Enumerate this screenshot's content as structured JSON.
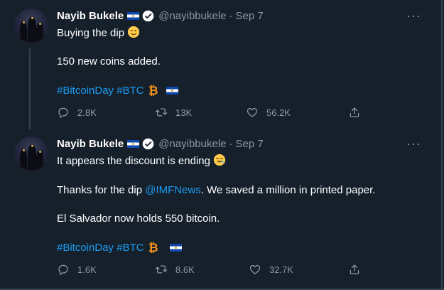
{
  "colors": {
    "background": "#15202b",
    "text": "#ffffff",
    "secondary": "#8b98a5",
    "link": "#1d9bf0",
    "bitcoin": "#f7931a"
  },
  "tweets": [
    {
      "author_name": "Nayib Bukele",
      "handle": "@nayibbukele",
      "separator": "·",
      "date": "Sep 7",
      "lines": {
        "line1": "Buying the dip",
        "line2": "150 new coins added.",
        "hashtag1": "#BitcoinDay",
        "hashtag2": "#BTC"
      },
      "replies": "2.8K",
      "retweets": "13K",
      "likes": "56.2K"
    },
    {
      "author_name": "Nayib Bukele",
      "handle": "@nayibbukele",
      "separator": "·",
      "date": "Sep 7",
      "lines": {
        "line1": "It appears the discount is ending",
        "line2_pre": "Thanks for the dip ",
        "mention": "@IMFNews",
        "line2_post": ". We saved a million in printed paper.",
        "line3": "El Salvador now holds 550 bitcoin.",
        "hashtag1": "#BitcoinDay",
        "hashtag2": "#BTC"
      },
      "replies": "1.6K",
      "retweets": "8.6K",
      "likes": "32.7K"
    }
  ]
}
